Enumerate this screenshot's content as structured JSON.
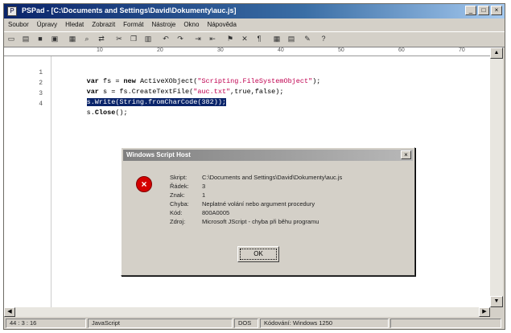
{
  "window": {
    "title": "PSPad - [C:\\Documents and Settings\\David\\Dokumenty\\auc.js]",
    "icon": "app-icon",
    "controls": [
      "_",
      "□",
      "×"
    ]
  },
  "menu": [
    "Soubor",
    "Úpravy",
    "Hledat",
    "Zobrazit",
    "Formát",
    "Nástroje",
    "Okno",
    "Nápověda"
  ],
  "toolbar_icons": [
    "new-icon",
    "open-icon",
    "save-icon",
    "saveall-icon",
    "print-icon",
    "find-icon",
    "replace-icon",
    "cut-icon",
    "copy-icon",
    "paste-icon",
    "undo-icon",
    "redo-icon",
    "indent-icon",
    "outdent-icon",
    "bookmark-icon",
    "delete-icon",
    "cut2-icon",
    "settings-icon",
    "tag-icon",
    "paint-icon",
    "help-icon"
  ],
  "ruler": [
    "10",
    "20",
    "30",
    "40",
    "50",
    "60",
    "70"
  ],
  "editor": {
    "lines": [
      {
        "num": "1",
        "parts": [
          {
            "t": "var",
            "c": "kw"
          },
          {
            "t": " fs = ",
            "c": ""
          },
          {
            "t": "new",
            "c": "kw"
          },
          {
            "t": " ActiveXObject(",
            "c": ""
          },
          {
            "t": "\"Scripting.FileSystemObject\"",
            "c": "str"
          },
          {
            "t": ");",
            "c": ""
          }
        ]
      },
      {
        "num": "2",
        "parts": [
          {
            "t": "var",
            "c": "kw"
          },
          {
            "t": " s = fs.CreateTextFile(",
            "c": ""
          },
          {
            "t": "\"auc.txt\"",
            "c": "str"
          },
          {
            "t": ",true,false);",
            "c": ""
          }
        ]
      },
      {
        "num": "3",
        "parts": [
          {
            "t": "s.Write(String.fromCharCode(382));",
            "c": "sel"
          }
        ]
      },
      {
        "num": "4",
        "parts": [
          {
            "t": "s.",
            "c": ""
          },
          {
            "t": "Close",
            "c": "kw"
          },
          {
            "t": "();",
            "c": ""
          }
        ]
      }
    ]
  },
  "dialog": {
    "title": "Windows Script Host",
    "close": "×",
    "icon": "error-icon",
    "icon_glyph": "×",
    "fields": [
      {
        "label": "Skript:",
        "value": "C:\\Documents and Settings\\David\\Dokumenty\\auc.js"
      },
      {
        "label": "Řádek:",
        "value": "3"
      },
      {
        "label": "Znak:",
        "value": "1"
      },
      {
        "label": "Chyba:",
        "value": "Neplatné volání nebo argument procedury"
      },
      {
        "label": "Kód:",
        "value": "800A0005"
      },
      {
        "label": "Zdroj:",
        "value": "Microsoft JScript - chyba při běhu programu"
      }
    ],
    "ok_label": "OK"
  },
  "status": {
    "position": "44 : 3 : 16",
    "syntax": "JavaScript",
    "line_end": "DOS",
    "encoding": "Kódování: Windows 1250"
  }
}
